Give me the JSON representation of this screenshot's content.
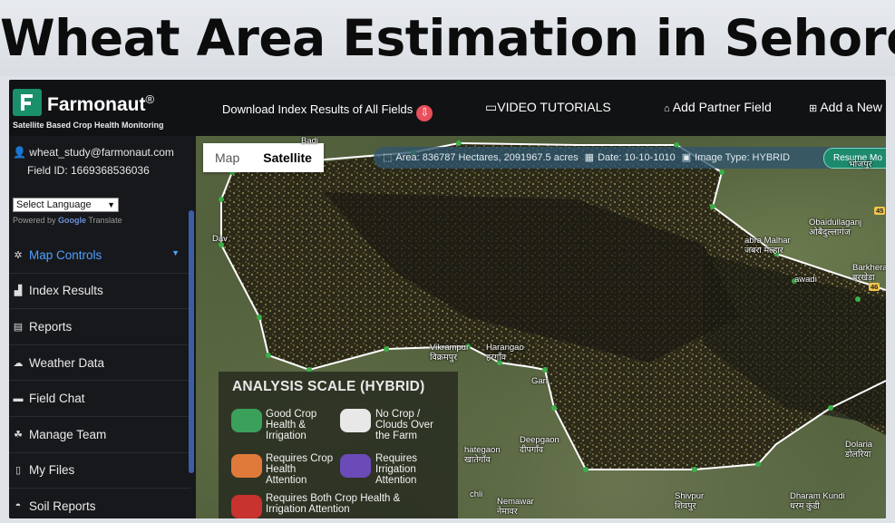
{
  "headline": "Wheat Area Estimation in Sehore",
  "app": {
    "brand": "Farmonaut",
    "brand_mark": "®",
    "tagline": "Satellite Based Crop Health Monitoring"
  },
  "topbar": {
    "download_label": "Download Index Results of All Fields",
    "video_tutorials": "VIDEO TUTORIALS",
    "add_partner_field": "Add Partner Field",
    "add_new": "Add a New"
  },
  "account": {
    "email": "wheat_study@farmonaut.com",
    "field_id": "Field ID: 1669368536036"
  },
  "language": {
    "selected": "Select Language",
    "powered_by": "Powered by",
    "google": "Google",
    "translate": "Translate"
  },
  "menu": [
    {
      "label": "Map Controls",
      "icon": "gear-icon",
      "active": true
    },
    {
      "label": "Index Results",
      "icon": "chart-icon"
    },
    {
      "label": "Reports",
      "icon": "document-icon"
    },
    {
      "label": "Weather Data",
      "icon": "cloud-icon"
    },
    {
      "label": "Field Chat",
      "icon": "chat-icon"
    },
    {
      "label": "Manage Team",
      "icon": "team-icon"
    },
    {
      "label": "My Files",
      "icon": "file-icon"
    },
    {
      "label": "Soil Reports",
      "icon": "soil-icon"
    }
  ],
  "map": {
    "toggle_map": "Map",
    "toggle_satellite": "Satellite",
    "area": "Area:  836787 Hectares, 2091967.5 acres",
    "date": "Date:   10-10-1010",
    "image_type": "Image Type:   HYBRID",
    "resume": "Resume Mo"
  },
  "places": {
    "vikrampur": "Vikrampur",
    "vikrampur_hi": "विक्रमपुर",
    "harangaon": "Harangao",
    "harangaon_hi": "हरगाँव",
    "deepgaon": "Deepgaon",
    "deepgaon_hi": "दीपगाँव",
    "chhategaon": "hategaon",
    "chhategaon_hi": "खातेगाँव",
    "nemawar": "Nemawar",
    "nemawar_hi": "नेमावर",
    "shivpur": "Shivpur",
    "shivpur_hi": "शिवपुर",
    "dharamkundi": "Dharam Kundi",
    "dharamkundi_hi": "धरम कुंडी",
    "dolaria": "Dolaria",
    "dolaria_hi": "डोलरिया",
    "obaidullaganj": "Obaidullaganj",
    "obaidullaganj_hi": "ओबैदुल्लागंज",
    "barkhera": "Barkhera",
    "barkhera_hi": "बरखेड़ा",
    "bhojpur_hi": "भोजपुर",
    "jabra": "abra Malhar",
    "jabra_hi": "जबरा मल्हार",
    "badi": "Badi",
    "dav": "Dav",
    "lawadi": "awadi",
    "ganj": "Gan",
    "chhli": "chli",
    "nh45": "45",
    "nh46": "46"
  },
  "legend": {
    "title": "ANALYSIS SCALE (HYBRID)",
    "items": [
      {
        "label": "Good Crop\nHealth  &\nIrrigation",
        "color": "#3aa05a"
      },
      {
        "label": "No Crop /\nClouds Over\nthe Farm",
        "color": "#e8e8e8"
      },
      {
        "label": "Requires Crop\nHealth\nAttention",
        "color": "#e07a3a"
      },
      {
        "label": "Requires\nIrrigation\nAttention",
        "color": "#6a4bb8"
      },
      {
        "label": "Requires Both Crop Health &\nIrrigation Attention",
        "color": "#c8322f"
      }
    ]
  },
  "colors": {
    "brand_green": "#1a8f6b",
    "accent_blue": "#4ea0ff",
    "download_red": "#e8505b"
  }
}
